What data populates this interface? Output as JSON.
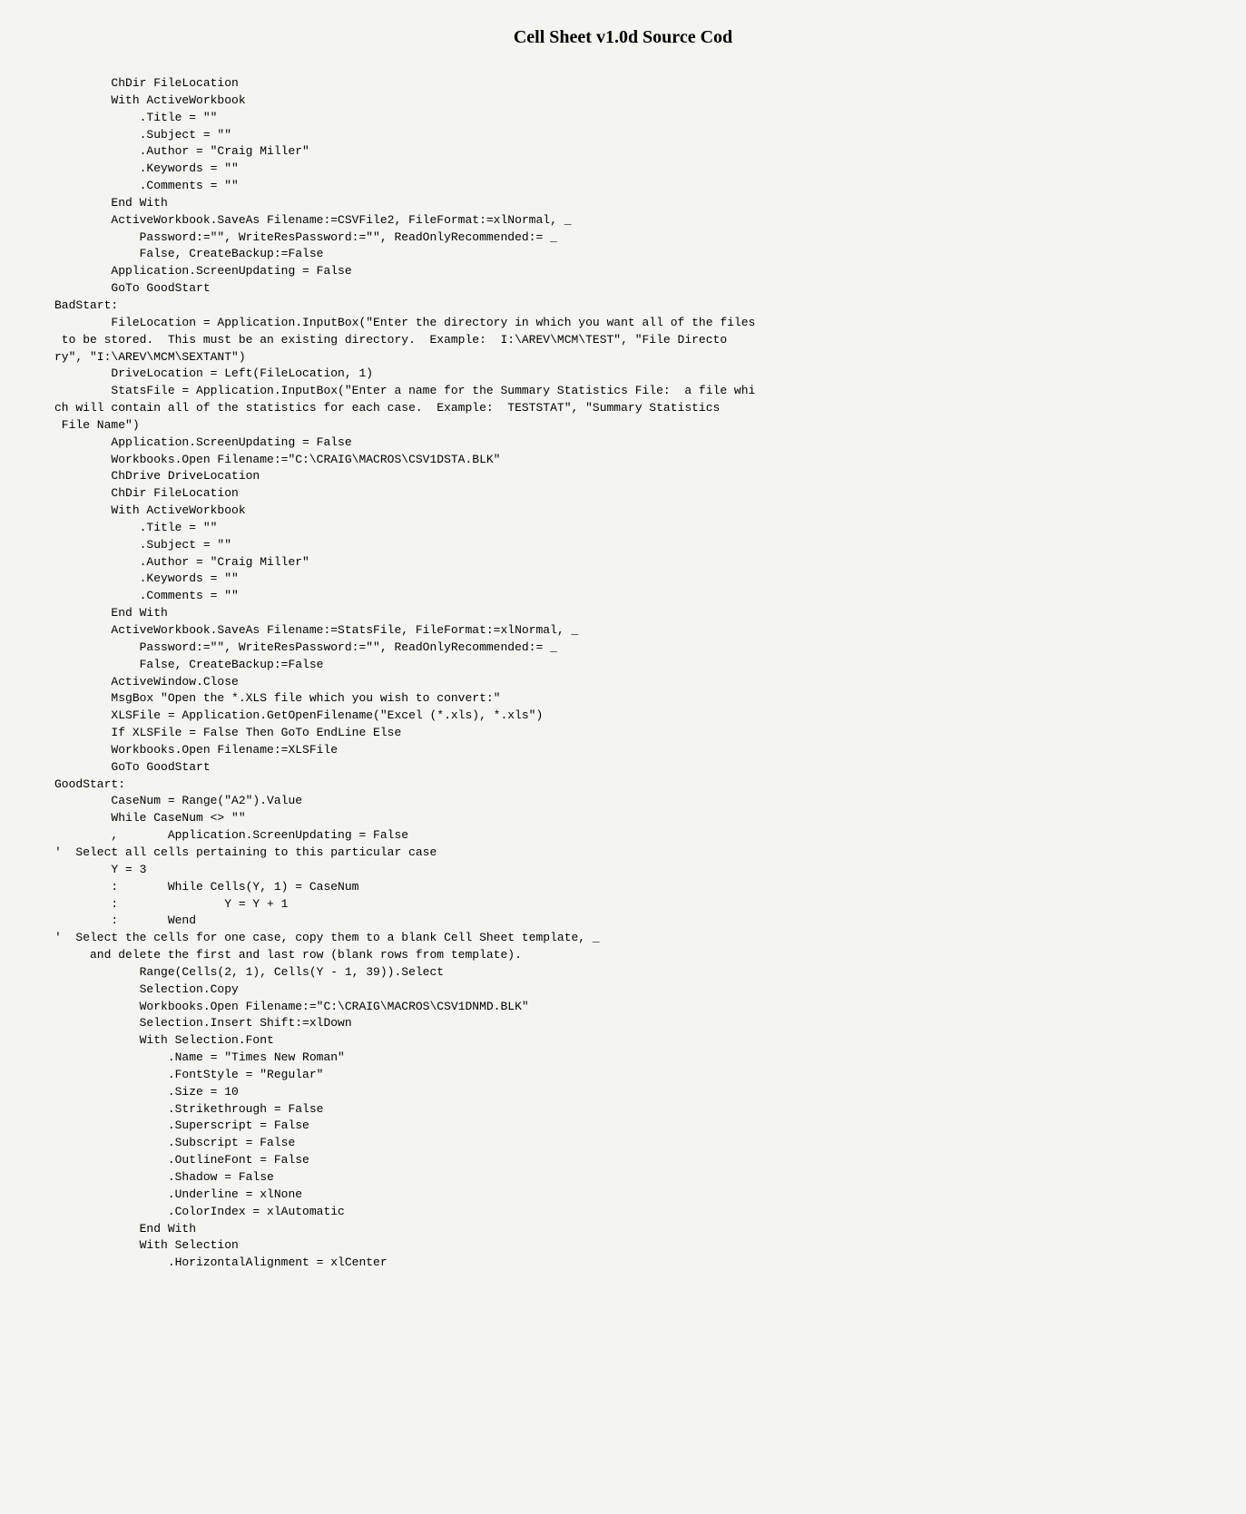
{
  "page": {
    "title": "Cell Sheet v1.0d Source Cod",
    "code": "        ChDir FileLocation\n        With ActiveWorkbook\n            .Title = \"\"\n            .Subject = \"\"\n            .Author = \"Craig Miller\"\n            .Keywords = \"\"\n            .Comments = \"\"\n        End With\n        ActiveWorkbook.SaveAs Filename:=CSVFile2, FileFormat:=xlNormal, _\n            Password:=\"\", WriteResPassword:=\"\", ReadOnlyRecommended:= _\n            False, CreateBackup:=False\n        Application.ScreenUpdating = False\n        GoTo GoodStart\nBadStart:\n        FileLocation = Application.InputBox(\"Enter the directory in which you want all of the files\n to be stored.  This must be an existing directory.  Example:  I:\\AREV\\MCM\\TEST\", \"File Directo\nry\", \"I:\\AREV\\MCM\\SEXTANT\")\n        DriveLocation = Left(FileLocation, 1)\n        StatsFile = Application.InputBox(\"Enter a name for the Summary Statistics File:  a file whi\nch will contain all of the statistics for each case.  Example:  TESTSTAT\", \"Summary Statistics\n File Name\")\n        Application.ScreenUpdating = False\n        Workbooks.Open Filename:=\"C:\\CRAIG\\MACROS\\CSV1DSTA.BLK\"\n        ChDrive DriveLocation\n        ChDir FileLocation\n        With ActiveWorkbook\n            .Title = \"\"\n            .Subject = \"\"\n            .Author = \"Craig Miller\"\n            .Keywords = \"\"\n            .Comments = \"\"\n        End With\n        ActiveWorkbook.SaveAs Filename:=StatsFile, FileFormat:=xlNormal, _\n            Password:=\"\", WriteResPassword:=\"\", ReadOnlyRecommended:= _\n            False, CreateBackup:=False\n        ActiveWindow.Close\n        MsgBox \"Open the *.XLS file which you wish to convert:\"\n        XLSFile = Application.GetOpenFilename(\"Excel (*.xls), *.xls\")\n        If XLSFile = False Then GoTo EndLine Else\n        Workbooks.Open Filename:=XLSFile\n        GoTo GoodStart\nGoodStart:\n        CaseNum = Range(\"A2\").Value\n        While CaseNum <> \"\"\n        ,       Application.ScreenUpdating = False\n'  Select all cells pertaining to this particular case\n        Y = 3\n        :       While Cells(Y, 1) = CaseNum\n        :               Y = Y + 1\n        :       Wend\n'  Select the cells for one case, copy them to a blank Cell Sheet template, _\n     and delete the first and last row (blank rows from template).\n            Range(Cells(2, 1), Cells(Y - 1, 39)).Select\n            Selection.Copy\n            Workbooks.Open Filename:=\"C:\\CRAIG\\MACROS\\CSV1DNMD.BLK\"\n            Selection.Insert Shift:=xlDown\n            With Selection.Font\n                .Name = \"Times New Roman\"\n                .FontStyle = \"Regular\"\n                .Size = 10\n                .Strikethrough = False\n                .Superscript = False\n                .Subscript = False\n                .OutlineFont = False\n                .Shadow = False\n                .Underline = xlNone\n                .ColorIndex = xlAutomatic\n            End With\n            With Selection\n                .HorizontalAlignment = xlCenter"
  }
}
